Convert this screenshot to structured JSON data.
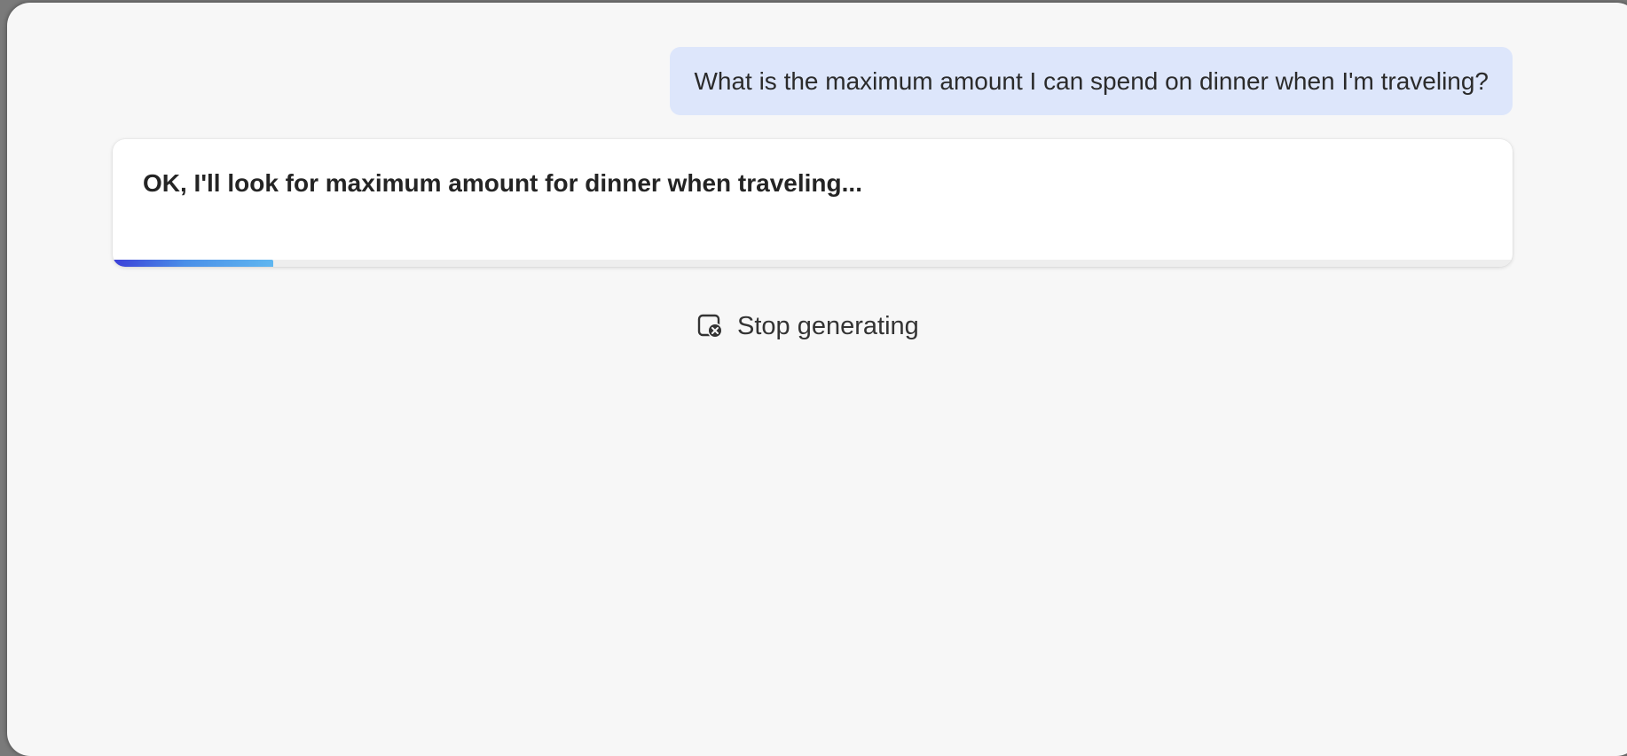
{
  "conversation": {
    "user_message": "What is the maximum amount I can spend on dinner when I'm traveling?",
    "assistant_status": "OK, I'll look for maximum amount for dinner when traveling...",
    "progress": 0.115
  },
  "controls": {
    "stop_label": "Stop generating",
    "stop_icon": "stop-generating-icon"
  },
  "colors": {
    "user_bubble": "#dde6fb",
    "card_background": "#ffffff",
    "page_background": "#f7f7f7",
    "progress_start": "#3b3fd8",
    "progress_end": "#5fb6f0"
  }
}
